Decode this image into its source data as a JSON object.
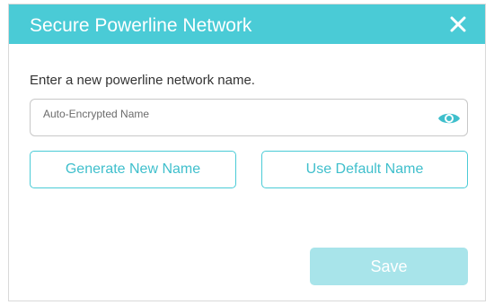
{
  "dialog": {
    "title": "Secure Powerline Network",
    "close_icon": "close-icon",
    "instruction": "Enter a new powerline network name.",
    "name_field": {
      "value": "",
      "placeholder": "Auto-Encrypted Name",
      "visibility_icon": "eye-icon"
    },
    "generate_button_label": "Generate New Name",
    "default_button_label": "Use Default Name",
    "save_button_label": "Save"
  },
  "colors": {
    "header": "#4acbd6",
    "accent": "#3fbfcc",
    "save_disabled": "#a8e4ea"
  }
}
